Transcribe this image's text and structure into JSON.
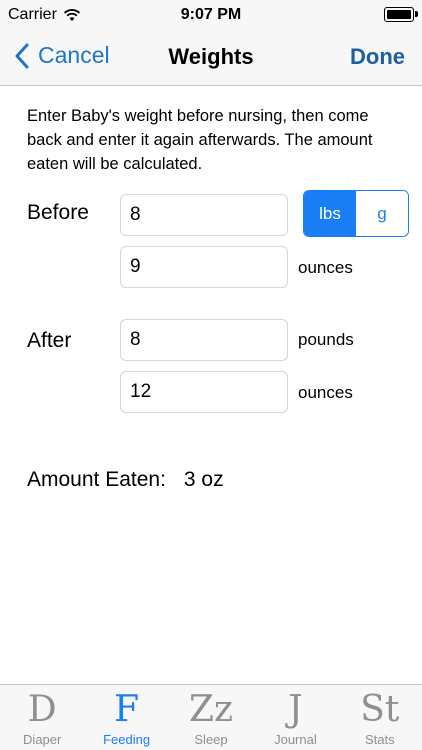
{
  "status_bar": {
    "carrier": "Carrier",
    "time": "9:07 PM",
    "battery_level": 1.0
  },
  "nav": {
    "cancel_label": "Cancel",
    "title": "Weights",
    "done_label": "Done"
  },
  "instructions": "Enter Baby's weight before nursing, then come back and enter it again afterwards. The amount eaten will be calculated.",
  "before": {
    "label": "Before",
    "pounds_value": "8",
    "ounces_value": "9",
    "ounces_unit": "ounces"
  },
  "unit_toggle": {
    "options": [
      "lbs",
      "g"
    ],
    "selected": "lbs"
  },
  "after": {
    "label": "After",
    "pounds_value": "8",
    "pounds_unit": "pounds",
    "ounces_value": "12",
    "ounces_unit": "ounces"
  },
  "amount_eaten": {
    "label": "Amount Eaten:",
    "value": "3 oz"
  },
  "tabs": [
    {
      "glyph": "D",
      "label": "Diaper",
      "active": false
    },
    {
      "glyph": "F",
      "label": "Feeding",
      "active": true
    },
    {
      "glyph": "Zz",
      "label": "Sleep",
      "active": false
    },
    {
      "glyph": "J",
      "label": "Journal",
      "active": false
    },
    {
      "glyph": "St",
      "label": "Stats",
      "active": false
    }
  ],
  "colors": {
    "accent": "#1a7ff5",
    "nav_text": "#1f5fa0",
    "inactive_tab": "#8e8e93"
  }
}
